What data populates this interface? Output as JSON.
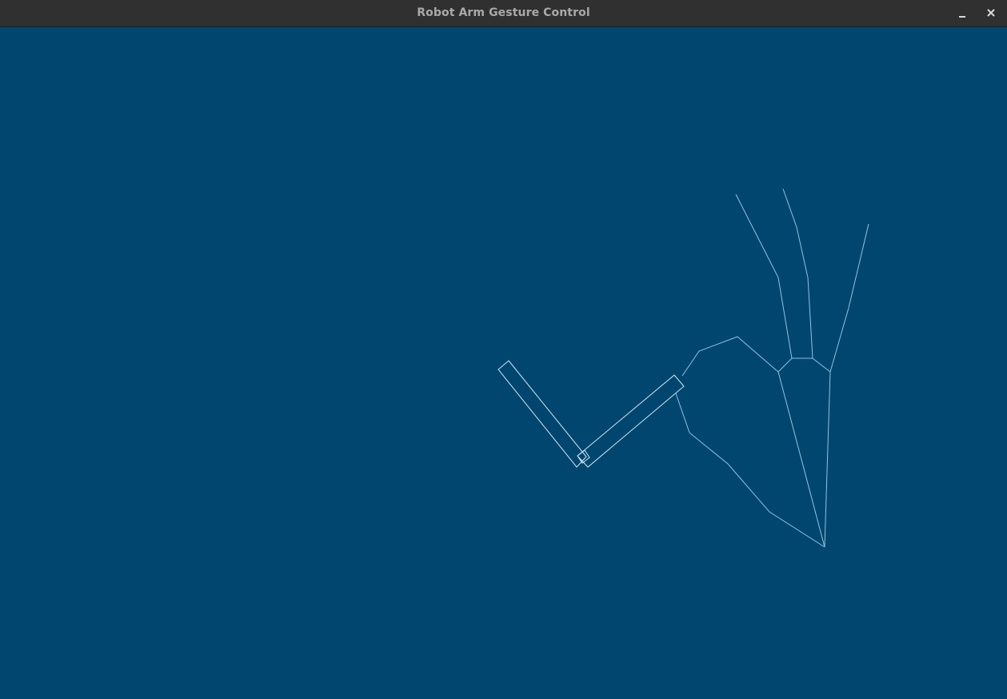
{
  "window": {
    "title": "Robot Arm Gesture Control"
  },
  "titlebar_buttons": [
    {
      "name": "minimize",
      "icon": "minimize-icon"
    },
    {
      "name": "close",
      "icon": "close-icon"
    }
  ],
  "colors": {
    "titlebar": "#303030",
    "title_text": "#a9a9a9",
    "canvas_background": "#00466f",
    "arm_stroke": "#cfe6f3",
    "hand_stroke": "#8fc3e0"
  },
  "scene": {
    "robot_arm": {
      "segments": [
        "upper-arm",
        "forearm"
      ],
      "joints": [
        "elbow-joint"
      ]
    },
    "hand_skeleton": {
      "parts": [
        "palm",
        "thumb",
        "index-finger",
        "middle-finger",
        "ring-finger"
      ]
    }
  }
}
